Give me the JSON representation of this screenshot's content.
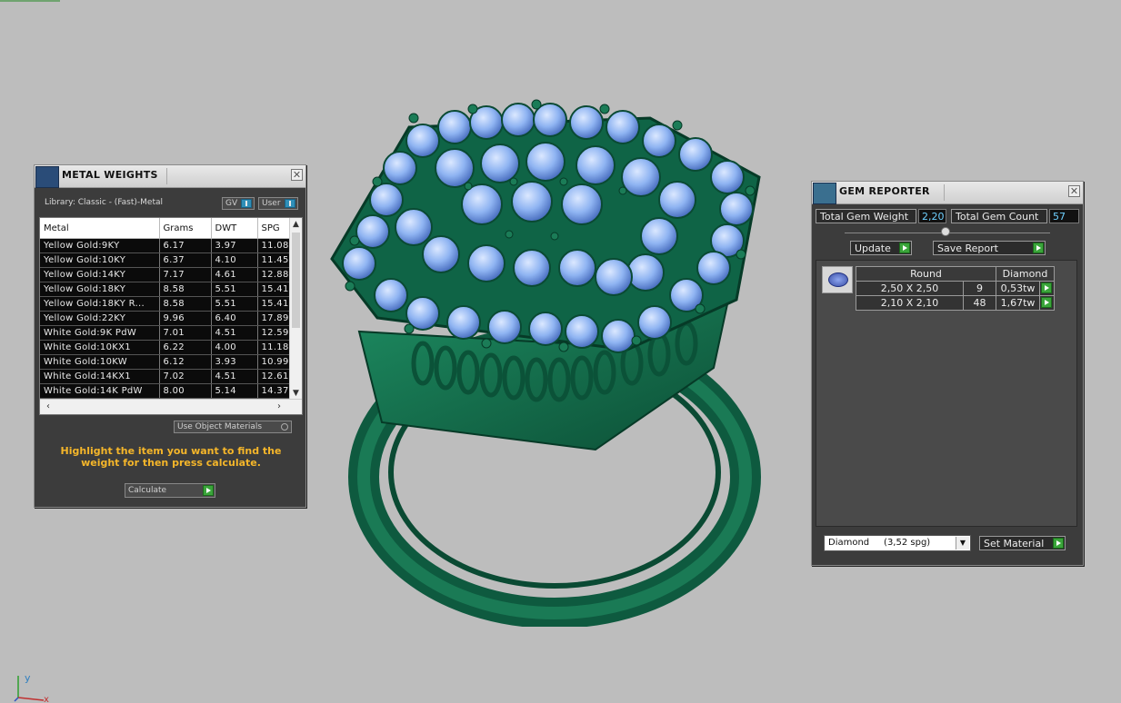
{
  "metal_weights": {
    "title": "METAL WEIGHTS",
    "library": "Library: Classic - (Fast)-Metal",
    "gv_label": "GV",
    "user_label": "User",
    "columns": [
      "Metal",
      "Grams",
      "DWT",
      "SPG"
    ],
    "rows": [
      [
        "Yellow Gold:9KY",
        "6.17",
        "3.97",
        "11.08"
      ],
      [
        "Yellow Gold:10KY",
        "6.37",
        "4.10",
        "11.45"
      ],
      [
        "Yellow Gold:14KY",
        "7.17",
        "4.61",
        "12.88"
      ],
      [
        "Yellow Gold:18KY",
        "8.58",
        "5.51",
        "15.41"
      ],
      [
        "Yellow Gold:18KY R...",
        "8.58",
        "5.51",
        "15.41"
      ],
      [
        "Yellow Gold:22KY",
        "9.96",
        "6.40",
        "17.89"
      ],
      [
        "White Gold:9K PdW",
        "7.01",
        "4.51",
        "12.59"
      ],
      [
        "White Gold:10KX1",
        "6.22",
        "4.00",
        "11.18"
      ],
      [
        "White Gold:10KW",
        "6.12",
        "3.93",
        "10.99"
      ],
      [
        "White Gold:14KX1",
        "7.02",
        "4.51",
        "12.61"
      ],
      [
        "White Gold:14K PdW",
        "8.00",
        "5.14",
        "14.37"
      ]
    ],
    "use_object_materials": "Use Object Materials",
    "hint": "Highlight the item you want to find the weight for then press calculate.",
    "calculate_label": "Calculate"
  },
  "gem_reporter": {
    "title": "GEM REPORTER",
    "total_gem_weight_label": "Total Gem Weight",
    "total_gem_weight": "2,20",
    "total_gem_count_label": "Total Gem Count",
    "total_gem_count": "57",
    "update_label": "Update",
    "save_report_label": "Save Report",
    "shape": "Round",
    "material": "Diamond",
    "gems": [
      {
        "size": "2,50 X 2,50",
        "count": "9",
        "weight": "0,53tw"
      },
      {
        "size": "2,10 X 2,10",
        "count": "48",
        "weight": "1,67tw"
      }
    ],
    "material_select": "Diamond     (3,52 spg)",
    "set_material_label": "Set Material"
  },
  "axes": {
    "x": "x",
    "y": "y"
  },
  "colors": {
    "background": "#bdbdbd",
    "panel": "#3c3c3c",
    "metal": "#136b4a",
    "gem": "#8fb4f2",
    "accent_green": "#3aa53a",
    "hint": "#f5b62a"
  }
}
